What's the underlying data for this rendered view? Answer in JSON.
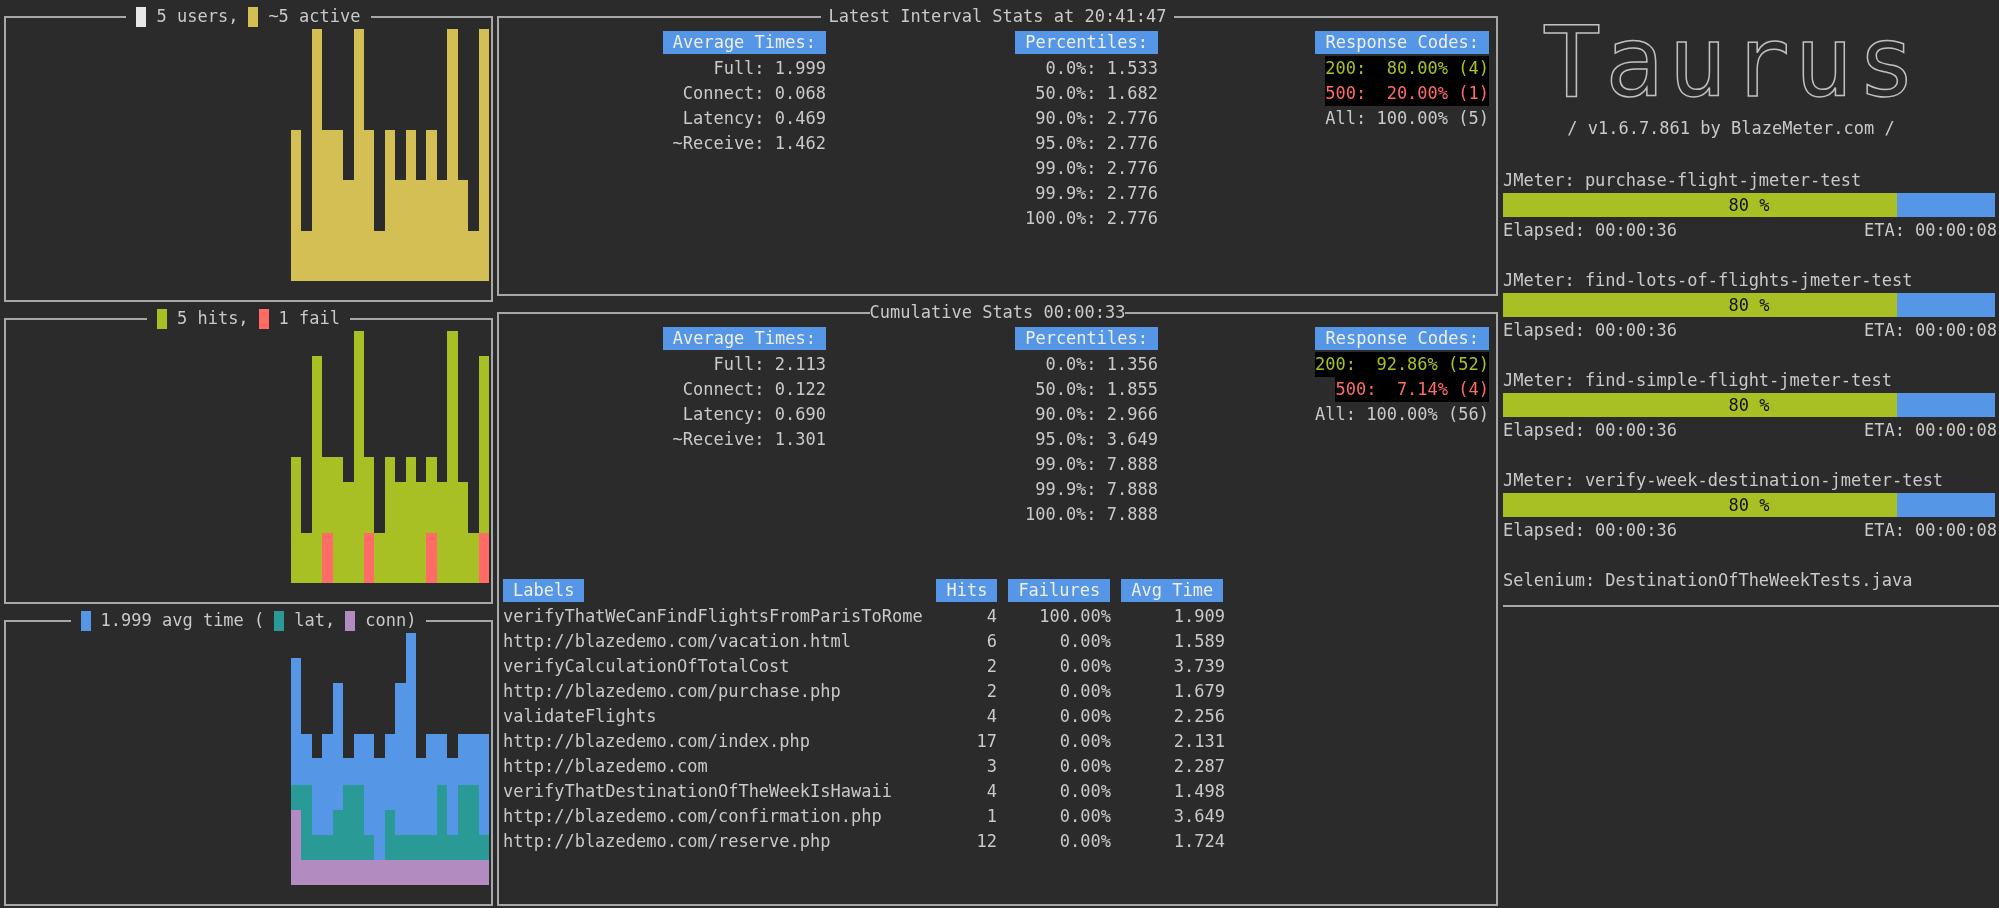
{
  "graphs": [
    {
      "kind": "users",
      "legend": [
        {
          "label": "5 users,",
          "color": "#e8e8e8"
        },
        {
          "label": "~5 active",
          "color": "#d4bf55"
        }
      ]
    },
    {
      "kind": "hits",
      "legend": [
        {
          "label": "5 hits,",
          "color": "#a8c023"
        },
        {
          "label": "1 fail",
          "color": "#ff6b66"
        }
      ]
    },
    {
      "kind": "times",
      "legend": [
        {
          "label": "1.999 avg time (",
          "color": "#5596e6"
        },
        {
          "label": "lat,",
          "color": "#2a9a96"
        },
        {
          "label": "conn)",
          "color": "#b28cc1"
        }
      ]
    }
  ],
  "interval_stats": {
    "title": "Latest Interval Stats at 20:41:47",
    "average_times": {
      "header": "Average Times:",
      "rows": [
        "Full: 1.999",
        "Connect: 0.068",
        "Latency: 0.469",
        "~Receive: 1.462"
      ]
    },
    "percentiles": {
      "header": "Percentiles:",
      "rows": [
        "0.0%: 1.533",
        "50.0%: 1.682",
        "90.0%: 2.776",
        "95.0%: 2.776",
        "99.0%: 2.776",
        "99.9%: 2.776",
        "100.0%: 2.776"
      ]
    },
    "response_codes": {
      "header": "Response Codes:",
      "codes": [
        {
          "text": "200:  80.00% (4)",
          "kind": "success"
        },
        {
          "text": "500:  20.00% (1)",
          "kind": "error"
        }
      ],
      "total": "All: 100.00% (5)"
    }
  },
  "cumulative_stats": {
    "title": "Cumulative Stats 00:00:33",
    "average_times": {
      "header": "Average Times:",
      "rows": [
        "Full: 2.113",
        "Connect: 0.122",
        "Latency: 0.690",
        "~Receive: 1.301"
      ]
    },
    "percentiles": {
      "header": "Percentiles:",
      "rows": [
        "0.0%: 1.356",
        "50.0%: 1.855",
        "90.0%: 2.966",
        "95.0%: 3.649",
        "99.0%: 7.888",
        "99.9%: 7.888",
        "100.0%: 7.888"
      ]
    },
    "response_codes": {
      "header": "Response Codes:",
      "codes": [
        {
          "text": "200:  92.86% (52)",
          "kind": "success"
        },
        {
          "text": "500:  7.14% (4)",
          "kind": "error"
        }
      ],
      "total": "All: 100.00% (56)"
    },
    "table": {
      "columns": [
        "Labels",
        "Hits",
        "Failures",
        "Avg Time"
      ],
      "rows": [
        [
          "verifyThatWeCanFindFlightsFromParisToRome",
          "4",
          "100.00%",
          "1.909"
        ],
        [
          "http://blazedemo.com/vacation.html",
          "6",
          "0.00%",
          "1.589"
        ],
        [
          "verifyCalculationOfTotalCost",
          "2",
          "0.00%",
          "3.739"
        ],
        [
          "http://blazedemo.com/purchase.php",
          "2",
          "0.00%",
          "1.679"
        ],
        [
          "validateFlights",
          "4",
          "0.00%",
          "2.256"
        ],
        [
          "http://blazedemo.com/index.php",
          "17",
          "0.00%",
          "2.131"
        ],
        [
          "http://blazedemo.com",
          "3",
          "0.00%",
          "2.287"
        ],
        [
          "verifyThatDestinationOfTheWeekIsHawaii",
          "4",
          "0.00%",
          "1.498"
        ],
        [
          "http://blazedemo.com/confirmation.php",
          "1",
          "0.00%",
          "3.649"
        ],
        [
          "http://blazedemo.com/reserve.php",
          "12",
          "0.00%",
          "1.724"
        ]
      ]
    }
  },
  "logo": {
    "text": "Taurus",
    "version": "/ v1.6.7.861 by BlazeMeter.com /"
  },
  "executors": [
    {
      "name": "JMeter: purchase-flight-jmeter-test",
      "level": 0.8,
      "percent": "80 %",
      "elapsed": "Elapsed: 00:00:36",
      "eta": "ETA: 00:00:08"
    },
    {
      "name": "JMeter: find-lots-of-flights-jmeter-test",
      "level": 0.8,
      "percent": "80 %",
      "elapsed": "Elapsed: 00:00:36",
      "eta": "ETA: 00:00:08"
    },
    {
      "name": "JMeter: find-simple-flight-jmeter-test",
      "level": 0.8,
      "percent": "80 %",
      "elapsed": "Elapsed: 00:00:36",
      "eta": "ETA: 00:00:08"
    },
    {
      "name": "JMeter: verify-week-destination-jmeter-test",
      "level": 0.8,
      "percent": "80 %",
      "elapsed": "Elapsed: 00:00:36",
      "eta": "ETA: 00:00:08"
    }
  ],
  "selenium": "Selenium: DestinationOfTheWeekTests.java"
}
